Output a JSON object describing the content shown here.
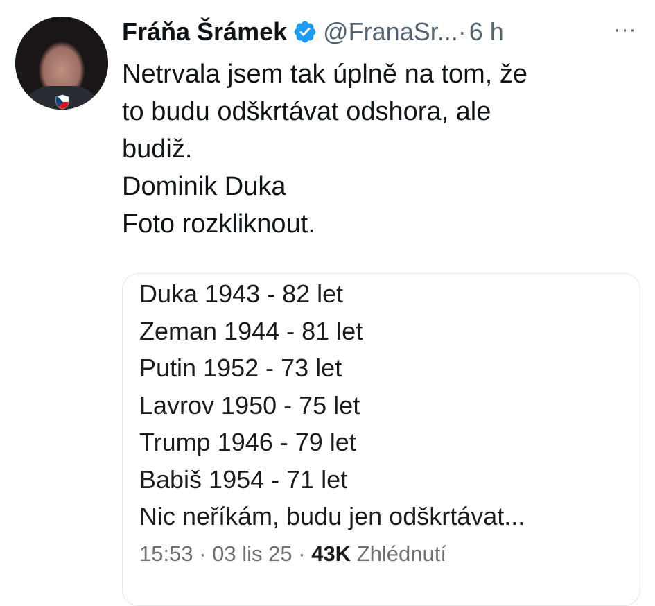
{
  "author": {
    "display_name": "Fráňa Šrámek",
    "handle": "@FranaSr...",
    "separator": "·",
    "time": "6 h",
    "verified": true,
    "verified_color": "#1d9bf0"
  },
  "more_label": "···",
  "tweet": {
    "lines": [
      "Netrvala jsem tak úplně na tom, že",
      "to budu odškrtávat odshora, ale",
      "budiž.",
      "Dominik Duka",
      "Foto rozkliknout."
    ]
  },
  "quoted": {
    "lines": [
      "Duka 1943 - 82 let",
      "Zeman 1944 - 81 let",
      "Putin 1952 - 73 let",
      "Lavrov 1950 - 75 let",
      "Trump 1946 - 79 let",
      "Babiš 1954 - 71 let",
      "Nic neříkám, budu jen odškrtávat..."
    ],
    "meta": {
      "time": "15:53",
      "sep1": "·",
      "date": "03 lis 25",
      "sep2": "·",
      "views_count": "43K",
      "views_label": "Zhlédnutí"
    }
  },
  "colors": {
    "text": "#0f1419",
    "secondary": "#536471",
    "card_border": "#e3e7ea"
  }
}
